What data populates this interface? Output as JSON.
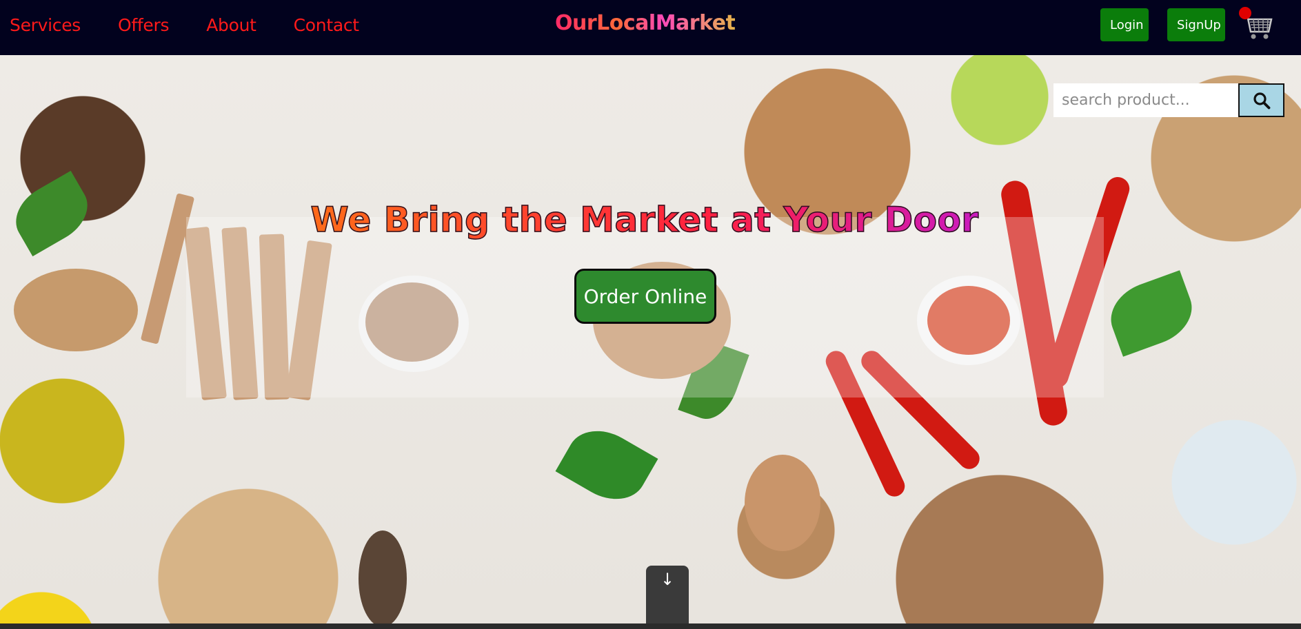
{
  "nav": {
    "links": [
      "Services",
      "Offers",
      "About",
      "Contact"
    ],
    "brand": "OurLocalMarket",
    "login_label": "Login",
    "signup_label": "SignUp",
    "cart_icon": "cart-icon"
  },
  "search": {
    "placeholder": "search product...",
    "button_icon": "search-icon"
  },
  "hero": {
    "title": "We Bring the Market at Your Door",
    "cta_label": "Order Online",
    "scroll_icon": "↓"
  },
  "colors": {
    "nav_bg": "#02021e",
    "nav_link": "#ff1a1a",
    "auth_button": "#0b7d0b",
    "cta_button": "#2e8a2e",
    "search_button": "#a9d6e5",
    "cart_badge": "#e00000"
  }
}
